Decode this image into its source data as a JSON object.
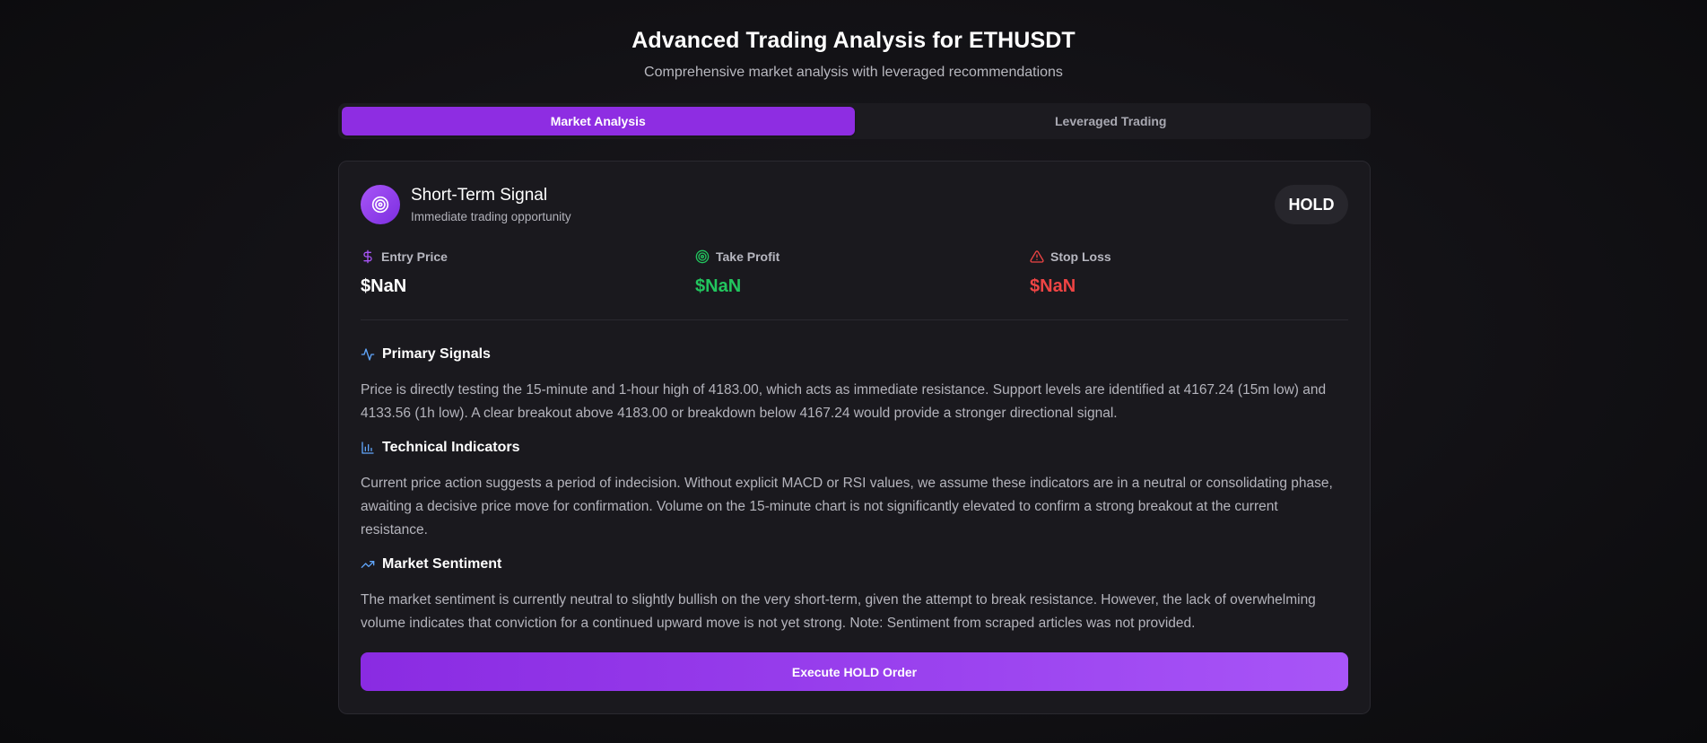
{
  "header": {
    "title": "Advanced Trading Analysis for ETHUSDT",
    "subtitle": "Comprehensive market analysis with leveraged recommendations"
  },
  "tabs": [
    {
      "label": "Market Analysis",
      "active": true
    },
    {
      "label": "Leveraged Trading",
      "active": false
    }
  ],
  "signal": {
    "icon": "target-icon",
    "title": "Short-Term Signal",
    "subtitle": "Immediate trading opportunity",
    "badge": "HOLD"
  },
  "metrics": [
    {
      "icon": "dollar-icon",
      "label": "Entry Price",
      "value": "$NaN",
      "color": "#ffffff"
    },
    {
      "icon": "target-icon",
      "label": "Take Profit",
      "value": "$NaN",
      "color": "#22c55e"
    },
    {
      "icon": "warning-triangle-icon",
      "label": "Stop Loss",
      "value": "$NaN",
      "color": "#ef4444"
    }
  ],
  "sections": [
    {
      "icon": "activity-icon",
      "title": "Primary Signals",
      "body": "Price is directly testing the 15-minute and 1-hour high of 4183.00, which acts as immediate resistance. Support levels are identified at 4167.24 (15m low) and 4133.56 (1h low). A clear breakout above 4183.00 or breakdown below 4167.24 would provide a stronger directional signal."
    },
    {
      "icon": "bar-chart-icon",
      "title": "Technical Indicators",
      "body": "Current price action suggests a period of indecision. Without explicit MACD or RSI values, we assume these indicators are in a neutral or consolidating phase, awaiting a decisive price move for confirmation. Volume on the 15-minute chart is not significantly elevated to confirm a strong breakout at the current resistance."
    },
    {
      "icon": "trending-up-icon",
      "title": "Market Sentiment",
      "body": "The market sentiment is currently neutral to slightly bullish on the very short-term, given the attempt to break resistance. However, the lack of overwhelming volume indicates that conviction for a continued upward move is not yet strong. Note: Sentiment from scraped articles was not provided."
    }
  ],
  "action": {
    "label": "Execute HOLD Order"
  },
  "colors": {
    "accent": "#8e2de2",
    "accent_light": "#a855f7",
    "positive": "#22c55e",
    "negative": "#ef4444",
    "section_icon": "#60a5fa"
  }
}
